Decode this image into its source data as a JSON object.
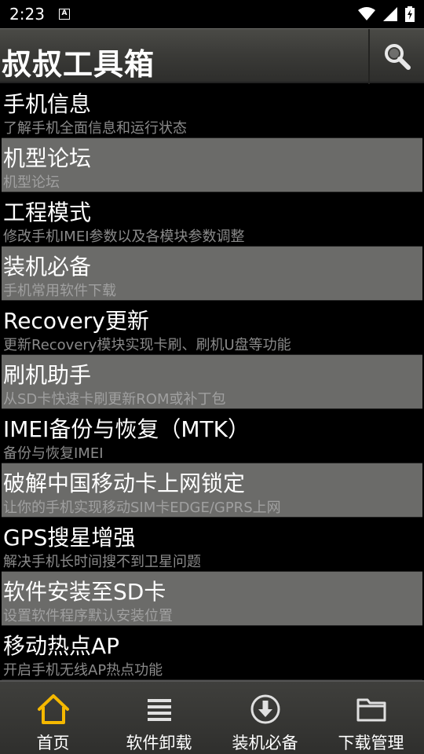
{
  "status": {
    "time": "2:23",
    "note_icon_label": "A"
  },
  "app": {
    "title": "叔叔工具箱"
  },
  "colors": {
    "accent": "#f5b800",
    "row_dark": "#000000",
    "row_light": "#6b6b69"
  },
  "items": [
    {
      "title": "手机信息",
      "desc": "了解手机全面信息和运行状态"
    },
    {
      "title": "机型论坛",
      "desc": "机型论坛"
    },
    {
      "title": "工程模式",
      "desc": "修改手机IMEI参数以及各模块参数调整"
    },
    {
      "title": "装机必备",
      "desc": "手机常用软件下载"
    },
    {
      "title": "Recovery更新",
      "desc": "更新Recovery模块实现卡刷、刷机U盘等功能"
    },
    {
      "title": "刷机助手",
      "desc": "从SD卡快速卡刷更新ROM或补丁包"
    },
    {
      "title": "IMEI备份与恢复（MTK）",
      "desc": "备份与恢复IMEI"
    },
    {
      "title": "破解中国移动卡上网锁定",
      "desc": "让你的手机实现移动SIM卡EDGE/GPRS上网"
    },
    {
      "title": "GPS搜星增强",
      "desc": "解决手机长时间搜不到卫星问题"
    },
    {
      "title": "软件安装至SD卡",
      "desc": "设置软件程序默认安装位置"
    },
    {
      "title": "移动热点AP",
      "desc": "开启手机无线AP热点功能"
    }
  ],
  "nav": [
    {
      "label": "首页",
      "icon": "home-icon"
    },
    {
      "label": "软件卸载",
      "icon": "list-icon"
    },
    {
      "label": "装机必备",
      "icon": "download-icon"
    },
    {
      "label": "下载管理",
      "icon": "folder-icon"
    }
  ]
}
